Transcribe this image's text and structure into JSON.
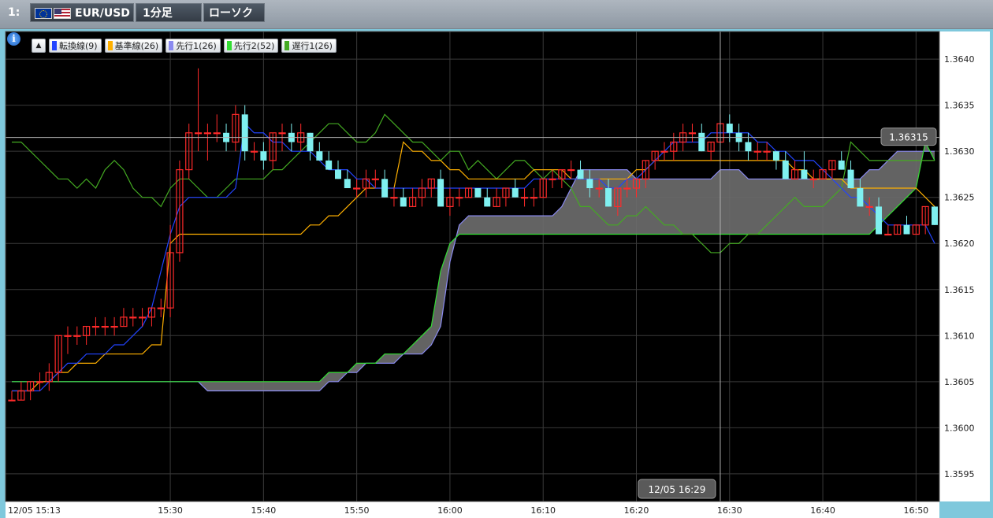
{
  "toolbar": {
    "window_index": "1:",
    "symbol": "EUR/USD",
    "timeframe": "1分足",
    "chart_type": "ローソク"
  },
  "legend": [
    {
      "label": "転換線(9)",
      "color": "#2244ff"
    },
    {
      "label": "基準線(26)",
      "color": "#ffb000"
    },
    {
      "label": "先行1(26)",
      "color": "#8a8af0"
    },
    {
      "label": "先行2(52)",
      "color": "#33dd33"
    },
    {
      "label": "遅行1(26)",
      "color": "#44aa22"
    }
  ],
  "colors": {
    "background": "#000000",
    "grid": "#3a3a3a",
    "up_candle": "#ff2a2a",
    "down_candle": "#7ff0f0",
    "cloud": "#6e6e6e",
    "crosshair": "#b0b0b0"
  },
  "crosshair": {
    "price_label": "1.36315",
    "time_label": "12/05 16:29"
  },
  "chart_data": {
    "type": "candlestick",
    "ylim": [
      1.3592,
      1.3643
    ],
    "x_ticks": [
      "12/05 15:13",
      "15:30",
      "15:40",
      "15:50",
      "16:00",
      "16:10",
      "16:20",
      "16:30",
      "16:40",
      "16:50"
    ],
    "y_ticks": [
      "1.3640",
      "1.3635",
      "1.3630",
      "1.3625",
      "1.3620",
      "1.3615",
      "1.3610",
      "1.3605",
      "1.3600",
      "1.3595"
    ],
    "x_start": "15:13",
    "x_end": "16:52",
    "cloud_displacement_min": 26,
    "candles": [
      [
        1.3603,
        1.3604,
        1.3603,
        1.3603
      ],
      [
        1.3603,
        1.3605,
        1.3603,
        1.3604
      ],
      [
        1.3604,
        1.3605,
        1.3603,
        1.3605
      ],
      [
        1.3605,
        1.3606,
        1.3604,
        1.3605
      ],
      [
        1.3605,
        1.3607,
        1.3604,
        1.3606
      ],
      [
        1.3606,
        1.361,
        1.3605,
        1.361
      ],
      [
        1.361,
        1.3611,
        1.3608,
        1.361
      ],
      [
        1.361,
        1.3611,
        1.3609,
        1.361
      ],
      [
        1.361,
        1.3611,
        1.3609,
        1.3611
      ],
      [
        1.3611,
        1.3612,
        1.361,
        1.3611
      ],
      [
        1.3611,
        1.3612,
        1.361,
        1.3611
      ],
      [
        1.3611,
        1.3612,
        1.361,
        1.3611
      ],
      [
        1.3611,
        1.3613,
        1.3611,
        1.3612
      ],
      [
        1.3612,
        1.3613,
        1.3611,
        1.3612
      ],
      [
        1.3612,
        1.3613,
        1.3611,
        1.3612
      ],
      [
        1.3612,
        1.3613,
        1.3611,
        1.3613
      ],
      [
        1.3613,
        1.3614,
        1.3612,
        1.3613
      ],
      [
        1.3613,
        1.3622,
        1.3612,
        1.3619
      ],
      [
        1.3619,
        1.3629,
        1.3618,
        1.3628
      ],
      [
        1.3628,
        1.3633,
        1.3627,
        1.3632
      ],
      [
        1.3632,
        1.3639,
        1.363,
        1.3632
      ],
      [
        1.3632,
        1.3633,
        1.3629,
        1.3632
      ],
      [
        1.3632,
        1.3634,
        1.3631,
        1.3632
      ],
      [
        1.3632,
        1.3633,
        1.363,
        1.3631
      ],
      [
        1.3631,
        1.3635,
        1.363,
        1.3634
      ],
      [
        1.3634,
        1.3635,
        1.3629,
        1.363
      ],
      [
        1.363,
        1.3631,
        1.3629,
        1.363
      ],
      [
        1.363,
        1.3631,
        1.3628,
        1.3629
      ],
      [
        1.3629,
        1.3632,
        1.3628,
        1.3632
      ],
      [
        1.3632,
        1.3633,
        1.363,
        1.3632
      ],
      [
        1.3632,
        1.3633,
        1.363,
        1.3631
      ],
      [
        1.3631,
        1.3633,
        1.363,
        1.3632
      ],
      [
        1.3632,
        1.3632,
        1.3629,
        1.363
      ],
      [
        1.363,
        1.3631,
        1.3629,
        1.3629
      ],
      [
        1.3629,
        1.363,
        1.3628,
        1.3628
      ],
      [
        1.3628,
        1.3629,
        1.3627,
        1.3627
      ],
      [
        1.3627,
        1.3628,
        1.3626,
        1.3626
      ],
      [
        1.3626,
        1.3627,
        1.3625,
        1.3626
      ],
      [
        1.3626,
        1.3628,
        1.3625,
        1.3627
      ],
      [
        1.3627,
        1.3628,
        1.3626,
        1.3627
      ],
      [
        1.3627,
        1.3628,
        1.3625,
        1.3625
      ],
      [
        1.3625,
        1.3626,
        1.3624,
        1.3625
      ],
      [
        1.3625,
        1.3626,
        1.3624,
        1.3624
      ],
      [
        1.3624,
        1.3626,
        1.3624,
        1.3625
      ],
      [
        1.3625,
        1.3627,
        1.3624,
        1.3626
      ],
      [
        1.3626,
        1.3627,
        1.3625,
        1.3627
      ],
      [
        1.3627,
        1.3628,
        1.3624,
        1.3624
      ],
      [
        1.3624,
        1.3626,
        1.3623,
        1.3625
      ],
      [
        1.3625,
        1.3626,
        1.3624,
        1.3625
      ],
      [
        1.3625,
        1.3626,
        1.3625,
        1.3626
      ],
      [
        1.3626,
        1.3626,
        1.3625,
        1.3625
      ],
      [
        1.3625,
        1.3626,
        1.3624,
        1.3624
      ],
      [
        1.3624,
        1.3626,
        1.3624,
        1.3625
      ],
      [
        1.3625,
        1.3626,
        1.3624,
        1.3626
      ],
      [
        1.3626,
        1.3627,
        1.3625,
        1.3625
      ],
      [
        1.3625,
        1.3626,
        1.3624,
        1.3625
      ],
      [
        1.3625,
        1.3626,
        1.3624,
        1.3625
      ],
      [
        1.3625,
        1.3627,
        1.3625,
        1.3627
      ],
      [
        1.3627,
        1.3628,
        1.3626,
        1.3627
      ],
      [
        1.3627,
        1.3628,
        1.3626,
        1.3628
      ],
      [
        1.3628,
        1.3629,
        1.3627,
        1.3628
      ],
      [
        1.3628,
        1.3629,
        1.3627,
        1.3627
      ],
      [
        1.3627,
        1.3628,
        1.3625,
        1.3626
      ],
      [
        1.3626,
        1.3627,
        1.3625,
        1.3626
      ],
      [
        1.3626,
        1.3627,
        1.3624,
        1.3624
      ],
      [
        1.3624,
        1.3626,
        1.3623,
        1.3626
      ],
      [
        1.3626,
        1.3627,
        1.3625,
        1.3626
      ],
      [
        1.3626,
        1.3627,
        1.3625,
        1.3627
      ],
      [
        1.3627,
        1.3629,
        1.3626,
        1.3629
      ],
      [
        1.3629,
        1.363,
        1.3628,
        1.363
      ],
      [
        1.363,
        1.3631,
        1.3629,
        1.363
      ],
      [
        1.363,
        1.3632,
        1.3629,
        1.3631
      ],
      [
        1.3631,
        1.3633,
        1.363,
        1.3632
      ],
      [
        1.3632,
        1.3633,
        1.3631,
        1.3632
      ],
      [
        1.3632,
        1.3633,
        1.363,
        1.363
      ],
      [
        1.363,
        1.3631,
        1.3629,
        1.3631
      ],
      [
        1.3631,
        1.3634,
        1.3631,
        1.3633
      ],
      [
        1.3633,
        1.3634,
        1.3631,
        1.3632
      ],
      [
        1.3632,
        1.3633,
        1.363,
        1.3631
      ],
      [
        1.3631,
        1.3632,
        1.3629,
        1.363
      ],
      [
        1.363,
        1.3631,
        1.3629,
        1.363
      ],
      [
        1.363,
        1.3631,
        1.3629,
        1.363
      ],
      [
        1.363,
        1.363,
        1.3628,
        1.3629
      ],
      [
        1.3629,
        1.363,
        1.3627,
        1.3627
      ],
      [
        1.3627,
        1.3629,
        1.3627,
        1.3628
      ],
      [
        1.3628,
        1.363,
        1.3627,
        1.3627
      ],
      [
        1.3627,
        1.3628,
        1.3626,
        1.3627
      ],
      [
        1.3627,
        1.3628,
        1.3627,
        1.3628
      ],
      [
        1.3628,
        1.3629,
        1.3627,
        1.3629
      ],
      [
        1.3629,
        1.363,
        1.3628,
        1.3628
      ],
      [
        1.3628,
        1.3629,
        1.3626,
        1.3626
      ],
      [
        1.3626,
        1.3627,
        1.3624,
        1.3624
      ],
      [
        1.3624,
        1.3625,
        1.3623,
        1.3624
      ],
      [
        1.3624,
        1.3625,
        1.3621,
        1.3621
      ],
      [
        1.3621,
        1.3622,
        1.3621,
        1.3621
      ],
      [
        1.3621,
        1.3622,
        1.3621,
        1.3622
      ],
      [
        1.3622,
        1.3623,
        1.3621,
        1.3621
      ],
      [
        1.3621,
        1.3622,
        1.3621,
        1.3622
      ],
      [
        1.3622,
        1.3624,
        1.3621,
        1.3624
      ],
      [
        1.3624,
        1.3624,
        1.3622,
        1.3622
      ]
    ],
    "tenkan_9": [
      1.3604,
      1.3604,
      1.3604,
      1.3604,
      1.3605,
      1.3606,
      1.3607,
      1.3607,
      1.3608,
      1.3608,
      1.3608,
      1.3609,
      1.3609,
      1.361,
      1.3611,
      1.3613,
      1.3617,
      1.3621,
      1.3624,
      1.3625,
      1.3625,
      1.3625,
      1.3625,
      1.3625,
      1.3626,
      1.3633,
      1.3632,
      1.3632,
      1.3631,
      1.3631,
      1.363,
      1.363,
      1.363,
      1.3629,
      1.3628,
      1.3628,
      1.3628,
      1.3627,
      1.3627,
      1.3626,
      1.3626,
      1.3626,
      1.3626,
      1.3626,
      1.3626,
      1.3626,
      1.3626,
      1.3626,
      1.3626,
      1.3626,
      1.3626,
      1.3626,
      1.3626,
      1.3626,
      1.3626,
      1.3626,
      1.3627,
      1.3627,
      1.3627,
      1.3627,
      1.3627,
      1.3627,
      1.3627,
      1.3627,
      1.3626,
      1.3626,
      1.3627,
      1.3627,
      1.3628,
      1.3629,
      1.363,
      1.3631,
      1.3631,
      1.3631,
      1.3631,
      1.3632,
      1.3632,
      1.3632,
      1.3632,
      1.3632,
      1.3631,
      1.3631,
      1.363,
      1.363,
      1.3629,
      1.3629,
      1.3629,
      1.3628,
      1.3627,
      1.3626,
      1.3625,
      1.3625,
      1.3624,
      1.3623,
      1.3622,
      1.3622,
      1.3622,
      1.3622,
      1.3622,
      1.362
    ],
    "kijun_26": [
      1.3604,
      1.3604,
      1.3604,
      1.3605,
      1.3605,
      1.3606,
      1.3606,
      1.3607,
      1.3607,
      1.3607,
      1.3608,
      1.3608,
      1.3608,
      1.3608,
      1.3608,
      1.3609,
      1.3609,
      1.362,
      1.3621,
      1.3621,
      1.3621,
      1.3621,
      1.3621,
      1.3621,
      1.3621,
      1.3621,
      1.3621,
      1.3621,
      1.3621,
      1.3621,
      1.3621,
      1.3621,
      1.3622,
      1.3622,
      1.3623,
      1.3623,
      1.3624,
      1.3625,
      1.3626,
      1.3626,
      1.3626,
      1.3626,
      1.3631,
      1.363,
      1.363,
      1.3629,
      1.3629,
      1.3628,
      1.3628,
      1.3627,
      1.3627,
      1.3627,
      1.3627,
      1.3627,
      1.3627,
      1.3627,
      1.3628,
      1.3628,
      1.3628,
      1.3628,
      1.3627,
      1.3627,
      1.3627,
      1.3627,
      1.3627,
      1.3627,
      1.3627,
      1.3628,
      1.3628,
      1.3629,
      1.3629,
      1.3629,
      1.3629,
      1.3629,
      1.3629,
      1.3629,
      1.3629,
      1.3629,
      1.3629,
      1.3629,
      1.3629,
      1.3629,
      1.3629,
      1.3629,
      1.3628,
      1.3628,
      1.3627,
      1.3627,
      1.3627,
      1.3627,
      1.3626,
      1.3626,
      1.3626,
      1.3626,
      1.3626,
      1.3626,
      1.3626,
      1.3626,
      1.3625,
      1.3624
    ],
    "senkou_a": [
      1.3605,
      1.3605,
      1.3605,
      1.3605,
      1.3605,
      1.3605,
      1.3605,
      1.3605,
      1.3605,
      1.3605,
      1.3605,
      1.3605,
      1.3605,
      1.3605,
      1.3605,
      1.3605,
      1.3605,
      1.3605,
      1.3605,
      1.3605,
      1.3605,
      1.3604,
      1.3604,
      1.3604,
      1.3604,
      1.3604,
      1.3604,
      1.3604,
      1.3604,
      1.3604,
      1.3604,
      1.3604,
      1.3604,
      1.3604,
      1.3605,
      1.3605,
      1.3606,
      1.3606,
      1.3607,
      1.3607,
      1.3607,
      1.3607,
      1.3608,
      1.3608,
      1.3608,
      1.3609,
      1.3611,
      1.3618,
      1.3622,
      1.3623,
      1.3623,
      1.3623,
      1.3623,
      1.3623,
      1.3623,
      1.3623,
      1.3623,
      1.3623,
      1.3623,
      1.3624,
      1.3626,
      1.3628,
      1.3628,
      1.3628,
      1.3628,
      1.3628,
      1.3628,
      1.3627,
      1.3627,
      1.3627,
      1.3627,
      1.3627,
      1.3627,
      1.3627,
      1.3627,
      1.3627,
      1.3628,
      1.3628,
      1.3628,
      1.3627,
      1.3627,
      1.3627,
      1.3627,
      1.3627,
      1.3627,
      1.3627,
      1.3627,
      1.3627,
      1.3627,
      1.3627,
      1.3627,
      1.3627,
      1.3628,
      1.3628,
      1.3629,
      1.363,
      1.363,
      1.363,
      1.363,
      1.363
    ],
    "senkou_b": [
      1.3605,
      1.3605,
      1.3605,
      1.3605,
      1.3605,
      1.3605,
      1.3605,
      1.3605,
      1.3605,
      1.3605,
      1.3605,
      1.3605,
      1.3605,
      1.3605,
      1.3605,
      1.3605,
      1.3605,
      1.3605,
      1.3605,
      1.3605,
      1.3605,
      1.3605,
      1.3605,
      1.3605,
      1.3605,
      1.3605,
      1.3605,
      1.3605,
      1.3605,
      1.3605,
      1.3605,
      1.3605,
      1.3605,
      1.3605,
      1.3606,
      1.3606,
      1.3606,
      1.3607,
      1.3607,
      1.3607,
      1.3608,
      1.3608,
      1.3608,
      1.3609,
      1.361,
      1.3611,
      1.3617,
      1.362,
      1.3621,
      1.3621,
      1.3621,
      1.3621,
      1.3621,
      1.3621,
      1.3621,
      1.3621,
      1.3621,
      1.3621,
      1.3621,
      1.3621,
      1.3621,
      1.3621,
      1.3621,
      1.3621,
      1.3621,
      1.3621,
      1.3621,
      1.3621,
      1.3621,
      1.3621,
      1.3621,
      1.3621,
      1.3621,
      1.3621,
      1.3621,
      1.3621,
      1.3621,
      1.3621,
      1.3621,
      1.3621,
      1.3621,
      1.3621,
      1.3621,
      1.3621,
      1.3621,
      1.3621,
      1.3621,
      1.3621,
      1.3621,
      1.3621,
      1.3621,
      1.3621,
      1.3621,
      1.3622,
      1.3623,
      1.3624,
      1.3625,
      1.3626,
      1.3631,
      1.3629
    ],
    "chikou_26": [
      1.3631,
      1.3631,
      1.363,
      1.3629,
      1.3628,
      1.3627,
      1.3627,
      1.3626,
      1.3627,
      1.3626,
      1.3628,
      1.3629,
      1.3628,
      1.3626,
      1.3625,
      1.3625,
      1.3624,
      1.3626,
      1.3627,
      1.3627,
      1.3626,
      1.3625,
      1.3625,
      1.3626,
      1.3627,
      1.3627,
      1.3627,
      1.3627,
      1.3628,
      1.3628,
      1.3629,
      1.363,
      1.3631,
      1.3632,
      1.3633,
      1.3633,
      1.3632,
      1.3631,
      1.3631,
      1.3632,
      1.3634,
      1.3633,
      1.3632,
      1.3631,
      1.3631,
      1.363,
      1.3629,
      1.363,
      1.363,
      1.3628,
      1.3629,
      1.3628,
      1.3627,
      1.3628,
      1.3629,
      1.3629,
      1.3628,
      1.3627,
      1.3628,
      1.3627,
      1.3626,
      1.3624,
      1.3624,
      1.3623,
      1.3622,
      1.3622,
      1.3623,
      1.3623,
      1.3624,
      1.3623,
      1.3622,
      1.3622,
      1.3621,
      1.3621,
      1.362,
      1.3619,
      1.3619,
      1.362,
      1.362,
      1.3621,
      1.3621,
      1.3622,
      1.3623,
      1.3624,
      1.3625,
      1.3624,
      1.3624,
      1.3624,
      1.3625,
      1.3626,
      1.3631,
      1.363,
      1.3629,
      1.3629,
      1.3629,
      1.3629,
      1.3629,
      1.3629,
      1.3629,
      1.3629
    ]
  }
}
